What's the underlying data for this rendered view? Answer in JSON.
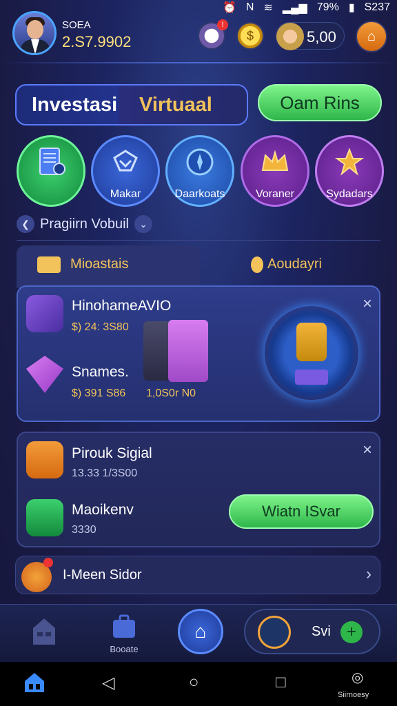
{
  "status_bar": {
    "battery": "79%",
    "time": "S237"
  },
  "header": {
    "user_name": "SOEA",
    "user_balance": "2.S7.9902",
    "balance_small": "5,00"
  },
  "title_tab": {
    "left": "Investasi",
    "right": "Virtuaal"
  },
  "top_button": "Oam Rins",
  "categories": [
    {
      "label": ""
    },
    {
      "label": "Makar"
    },
    {
      "label": "Daarkoats"
    },
    {
      "label": "Voraner"
    },
    {
      "label": "Sydadars"
    }
  ],
  "sub_nav": {
    "label": "Pragiirn Vobuil"
  },
  "tabs": [
    {
      "label": "Mioastais"
    },
    {
      "label": "Aoudayri"
    }
  ],
  "card1": {
    "row1": {
      "title": "HinohameAVIO",
      "value": "$) 24: 3S80"
    },
    "row2": {
      "title": "Snames.",
      "value": "$) 391 S86",
      "value2": "1,0S0r  N0"
    }
  },
  "card2": {
    "row1": {
      "title": "Pirouk Sigial",
      "value": "13.33 1/3S00"
    },
    "row2": {
      "title": "Maoikenv",
      "value": "3330"
    },
    "button": "Wiatn ISvar"
  },
  "menu_row": {
    "label": "I-Meen Sidor"
  },
  "bottom_nav": {
    "item2_label": "Booate",
    "pill_text": "Svi"
  },
  "system_nav": {
    "right_label": "Siirnoesy"
  },
  "colors": {
    "accent": "#5b7bff",
    "gold": "#f2c35a",
    "green": "#2fb64a"
  }
}
